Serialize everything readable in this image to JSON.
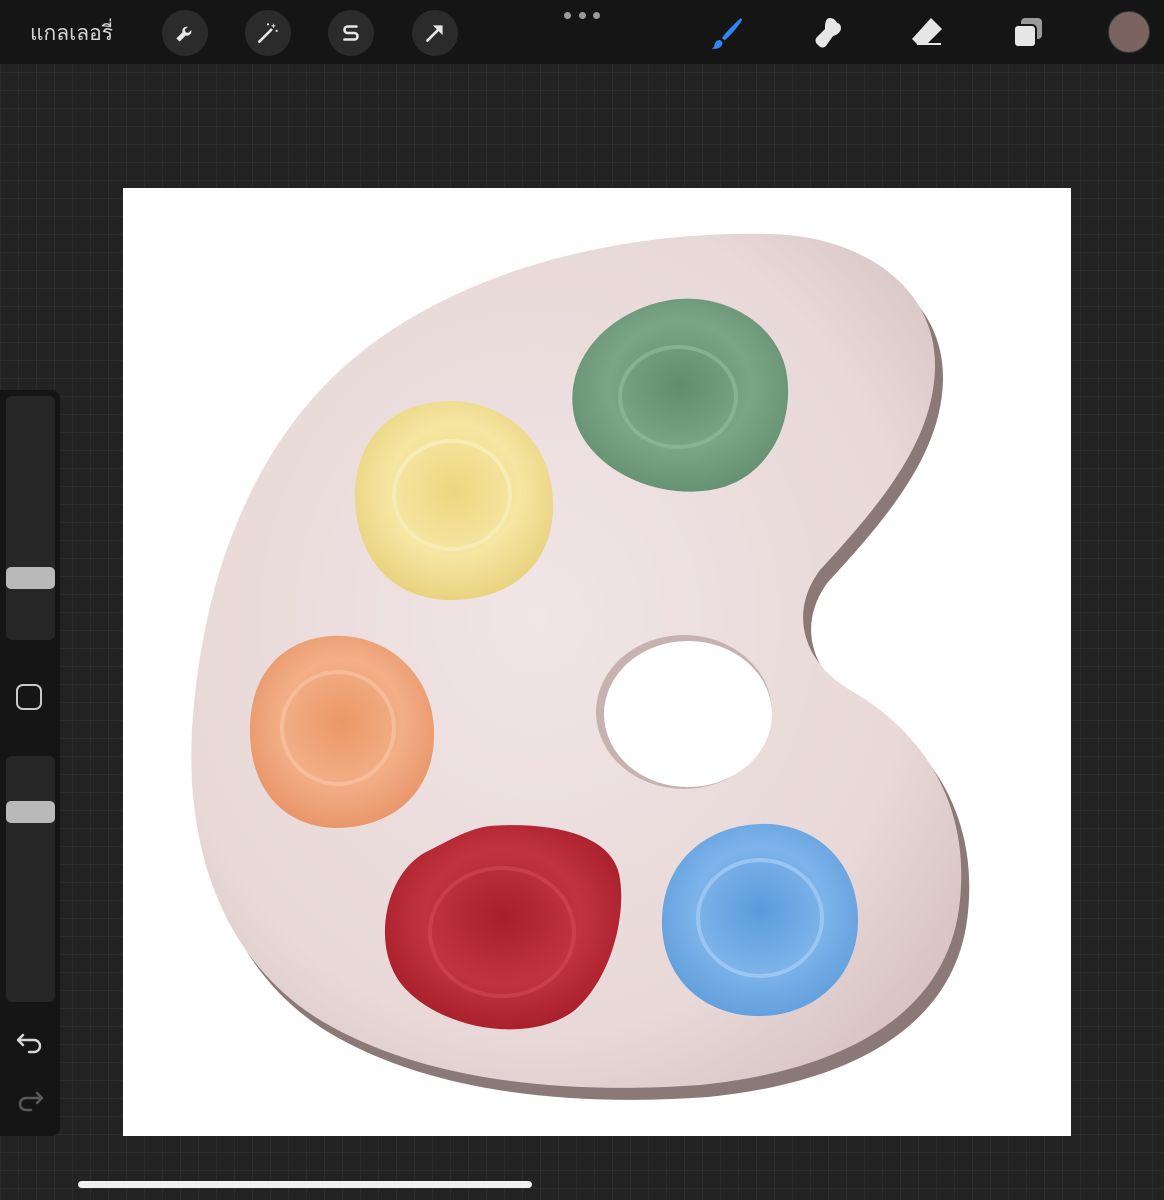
{
  "topbar": {
    "gallery_label": "แกลเลอรี่",
    "left_tools": [
      "wrench-icon",
      "magic-wand-icon",
      "selection-s-icon",
      "transform-arrow-icon"
    ],
    "right_tools": [
      "brush-icon",
      "smudge-icon",
      "eraser-icon",
      "layers-icon"
    ],
    "active_tool": "brush",
    "active_color": "#7b6460",
    "accent_color": "#2f86f6"
  },
  "sidebar": {
    "brush_size_level": 0.23,
    "opacity_level": 0.8,
    "icons": [
      "modify-square-icon",
      "undo-icon",
      "redo-icon"
    ]
  },
  "canvas": {
    "background": "#ffffff",
    "palette_color": "#ebdcdc",
    "paints": [
      {
        "name": "green",
        "color": "#6f9b7c"
      },
      {
        "name": "yellow",
        "color": "#f0dd8c"
      },
      {
        "name": "orange",
        "color": "#ef9e72"
      },
      {
        "name": "red",
        "color": "#b4242e"
      },
      {
        "name": "blue",
        "color": "#6aa6e2"
      }
    ]
  }
}
